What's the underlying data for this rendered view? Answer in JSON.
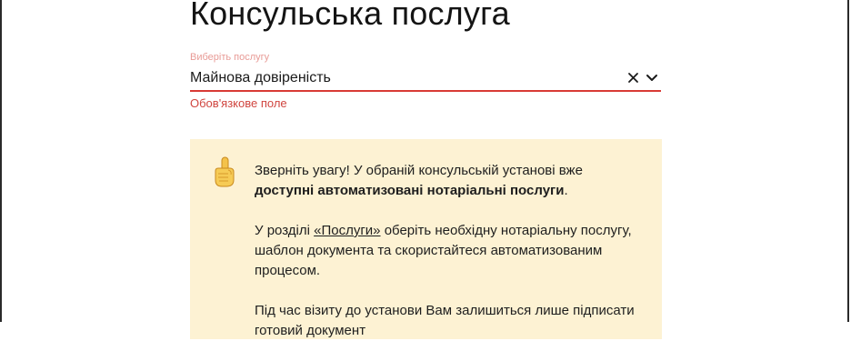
{
  "page": {
    "title": "Консульська послуга"
  },
  "service_field": {
    "label": "Виберіть послугу",
    "value": "Майнова довіреність",
    "error": "Обов'язкове поле",
    "clear_icon": "close-icon",
    "dropdown_icon": "chevron-down-icon"
  },
  "notice": {
    "icon": "pointing-finger-icon",
    "p1_text": "Зверніть увагу! У обраній консульській установі вже ",
    "p1_bold": "доступні автоматизовані нотаріальні послуги",
    "p1_end": ".",
    "p2_start": "У розділі ",
    "p2_link": "«Послуги»",
    "p2_end": " оберіть необхідну нотаріальну послугу, шаблон документа та скористайтеся автоматизованим процесом.",
    "p3": "Під час візиту до установи Вам залишиться лише підписати готовий документ"
  },
  "colors": {
    "accent_red": "#d83a35",
    "notice_bg": "#fdf2d3",
    "label_pink": "#e89b96"
  }
}
